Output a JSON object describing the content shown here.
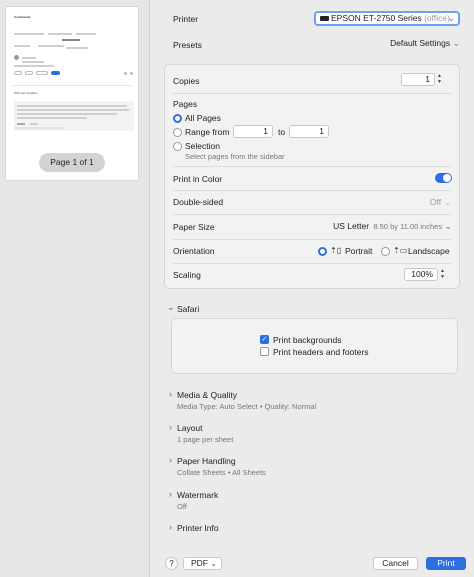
{
  "preview": {
    "page_indicator": "Page 1 of 1",
    "mini_title": "Community",
    "mini_heading": "Print out of option"
  },
  "printer": {
    "label": "Printer",
    "value": "EPSON ET-2750 Series",
    "location": "(office)"
  },
  "presets": {
    "label": "Presets",
    "value": "Default Settings"
  },
  "copies": {
    "label": "Copies",
    "value": "1"
  },
  "pages": {
    "label": "Pages",
    "all_label": "All Pages",
    "range_label": "Range from",
    "range_from": "1",
    "range_to_label": "to",
    "range_to": "1",
    "selection_label": "Selection",
    "selection_hint": "Select pages from the sidebar",
    "selected": "All Pages"
  },
  "print_in_color": {
    "label": "Print in Color",
    "on": true
  },
  "double_sided": {
    "label": "Double-sided",
    "value": "Off"
  },
  "paper_size": {
    "label": "Paper Size",
    "value": "US Letter",
    "detail": "8.50 by 11.00 inches"
  },
  "orientation": {
    "label": "Orientation",
    "portrait": "Portrait",
    "landscape": "Landscape",
    "selected": "Portrait"
  },
  "scaling": {
    "label": "Scaling",
    "value": "100%"
  },
  "safari": {
    "label": "Safari",
    "print_backgrounds": "Print backgrounds",
    "print_backgrounds_checked": true,
    "print_headers": "Print headers and footers",
    "print_headers_checked": false
  },
  "sections": [
    {
      "title": "Media & Quality",
      "subtitle": "Media Type: Auto Select • Quality: Normal"
    },
    {
      "title": "Layout",
      "subtitle": "1 page per sheet"
    },
    {
      "title": "Paper Handling",
      "subtitle": "Collate Sheets • All Sheets"
    },
    {
      "title": "Watermark",
      "subtitle": "Off"
    },
    {
      "title": "Printer Info",
      "subtitle": ""
    }
  ],
  "footer": {
    "help": "?",
    "pdf": "PDF",
    "cancel": "Cancel",
    "print": "Print"
  },
  "colors": {
    "accent": "#2b6fe0"
  },
  "icons": [
    "printer-icon",
    "portrait-icon",
    "landscape-icon",
    "chevron-right-icon",
    "chevron-down-icon",
    "stepper-icon",
    "checkmark-icon"
  ]
}
